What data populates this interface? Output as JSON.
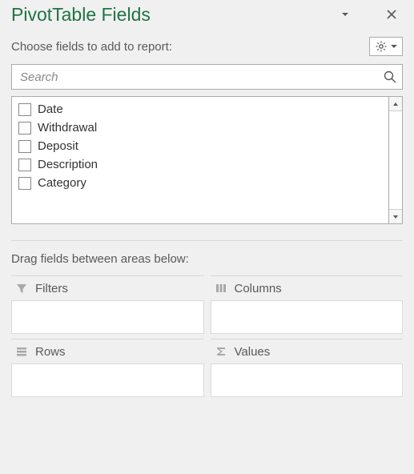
{
  "header": {
    "title": "PivotTable Fields"
  },
  "subtitle": "Choose fields to add to report:",
  "search": {
    "placeholder": "Search"
  },
  "fields": {
    "items": [
      {
        "label": "Date"
      },
      {
        "label": "Withdrawal"
      },
      {
        "label": "Deposit"
      },
      {
        "label": "Description"
      },
      {
        "label": "Category"
      }
    ]
  },
  "drag_label": "Drag fields between areas below:",
  "areas": {
    "filters": {
      "label": "Filters"
    },
    "columns": {
      "label": "Columns"
    },
    "rows": {
      "label": "Rows"
    },
    "values": {
      "label": "Values"
    }
  },
  "icons": {
    "dropdown": "chevron-down",
    "close": "close",
    "gear": "gear",
    "search": "search",
    "filter": "filter",
    "columns": "columns",
    "rows": "rows",
    "sigma": "sigma",
    "up": "up",
    "down": "down"
  }
}
